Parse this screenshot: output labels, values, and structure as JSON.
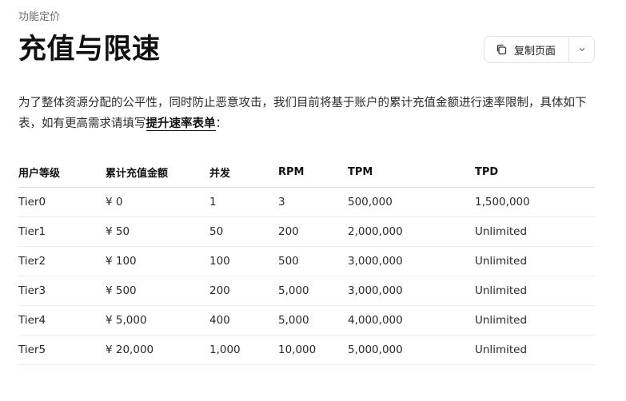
{
  "breadcrumb": "功能定价",
  "title": "充值与限速",
  "copy_button": {
    "label": "复制页面"
  },
  "intro": {
    "text": "为了整体资源分配的公平性，同时防止恶意攻击，我们目前将基于账户的累计充值金额进行速率限制，具体如下表，如有更高需求请填写",
    "link_text": "提升速率表单",
    "suffix": "："
  },
  "table": {
    "headers": [
      "用户等级",
      "累计充值金额",
      "并发",
      "RPM",
      "TPM",
      "TPD"
    ],
    "rows": [
      [
        "Tier0",
        "¥ 0",
        "1",
        "3",
        "500,000",
        "1,500,000"
      ],
      [
        "Tier1",
        "¥ 50",
        "50",
        "200",
        "2,000,000",
        "Unlimited"
      ],
      [
        "Tier2",
        "¥ 100",
        "100",
        "500",
        "3,000,000",
        "Unlimited"
      ],
      [
        "Tier3",
        "¥ 500",
        "200",
        "5,000",
        "3,000,000",
        "Unlimited"
      ],
      [
        "Tier4",
        "¥ 5,000",
        "400",
        "5,000",
        "4,000,000",
        "Unlimited"
      ],
      [
        "Tier5",
        "¥ 20,000",
        "1,000",
        "10,000",
        "5,000,000",
        "Unlimited"
      ]
    ]
  },
  "icons": {
    "copy": "copy-icon",
    "dropdown": "chevron-down-icon"
  }
}
